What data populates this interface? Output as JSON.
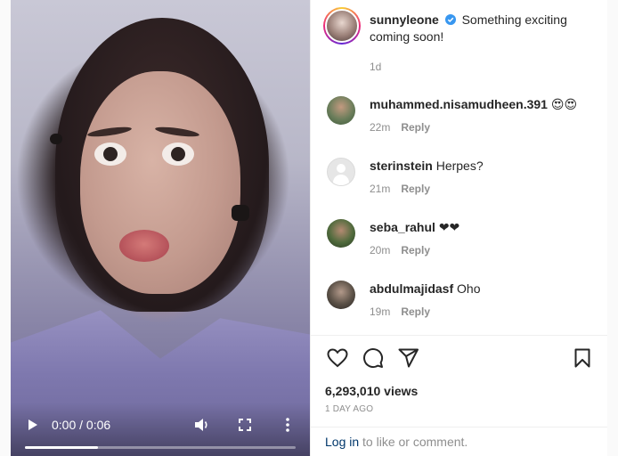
{
  "video": {
    "time": "0:00 / 0:06",
    "progress_fraction": 0.27,
    "icons": {
      "play": "play-icon",
      "volume": "volume-icon",
      "fullscreen": "fullscreen-icon",
      "more": "more-vertical-icon"
    }
  },
  "post": {
    "author": "sunnyleone",
    "verified": true,
    "caption": "Something exciting coming soon!",
    "time": "1d"
  },
  "comments": [
    {
      "user": "muhammed.nisamudheen.391",
      "text": "😍😍",
      "time": "22m",
      "reply": "Reply"
    },
    {
      "user": "sterinstein",
      "text": "Herpes?",
      "time": "21m",
      "reply": "Reply"
    },
    {
      "user": "seba_rahul",
      "text": "❤❤",
      "time": "20m",
      "reply": "Reply"
    },
    {
      "user": "abdulmajidasf",
      "text": "Oho",
      "time": "19m",
      "reply": "Reply"
    }
  ],
  "actions": {
    "icons": [
      "heart-icon",
      "comment-icon",
      "share-icon",
      "bookmark-icon"
    ]
  },
  "stats": {
    "views": "6,293,010 views",
    "date": "1 DAY AGO"
  },
  "footer": {
    "login": "Log in",
    "rest": " to like or comment."
  },
  "colors": {
    "link": "#00376b",
    "muted": "#8e8e8e",
    "verified": "#3897f0"
  }
}
